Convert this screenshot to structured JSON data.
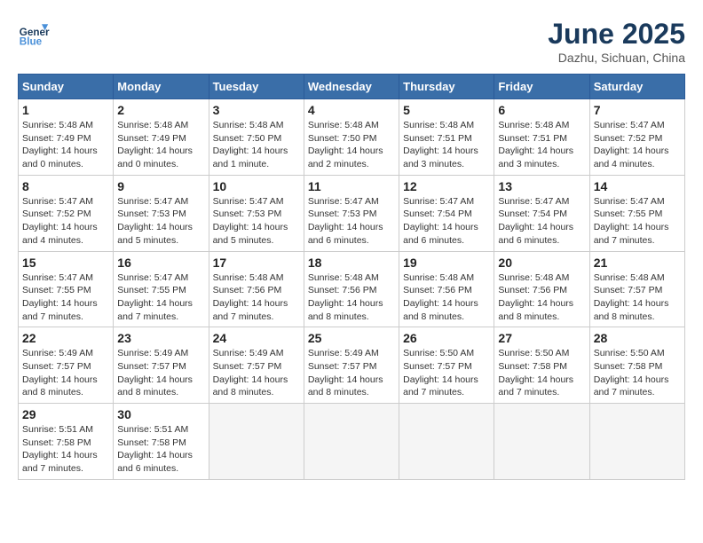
{
  "header": {
    "logo_line1": "General",
    "logo_line2": "Blue",
    "month": "June 2025",
    "location": "Dazhu, Sichuan, China"
  },
  "weekdays": [
    "Sunday",
    "Monday",
    "Tuesday",
    "Wednesday",
    "Thursday",
    "Friday",
    "Saturday"
  ],
  "weeks": [
    [
      {
        "day": "1",
        "sunrise": "5:48 AM",
        "sunset": "7:49 PM",
        "daylight": "14 hours and 0 minutes."
      },
      {
        "day": "2",
        "sunrise": "5:48 AM",
        "sunset": "7:49 PM",
        "daylight": "14 hours and 0 minutes."
      },
      {
        "day": "3",
        "sunrise": "5:48 AM",
        "sunset": "7:50 PM",
        "daylight": "14 hours and 1 minute."
      },
      {
        "day": "4",
        "sunrise": "5:48 AM",
        "sunset": "7:50 PM",
        "daylight": "14 hours and 2 minutes."
      },
      {
        "day": "5",
        "sunrise": "5:48 AM",
        "sunset": "7:51 PM",
        "daylight": "14 hours and 3 minutes."
      },
      {
        "day": "6",
        "sunrise": "5:48 AM",
        "sunset": "7:51 PM",
        "daylight": "14 hours and 3 minutes."
      },
      {
        "day": "7",
        "sunrise": "5:47 AM",
        "sunset": "7:52 PM",
        "daylight": "14 hours and 4 minutes."
      }
    ],
    [
      {
        "day": "8",
        "sunrise": "5:47 AM",
        "sunset": "7:52 PM",
        "daylight": "14 hours and 4 minutes."
      },
      {
        "day": "9",
        "sunrise": "5:47 AM",
        "sunset": "7:53 PM",
        "daylight": "14 hours and 5 minutes."
      },
      {
        "day": "10",
        "sunrise": "5:47 AM",
        "sunset": "7:53 PM",
        "daylight": "14 hours and 5 minutes."
      },
      {
        "day": "11",
        "sunrise": "5:47 AM",
        "sunset": "7:53 PM",
        "daylight": "14 hours and 6 minutes."
      },
      {
        "day": "12",
        "sunrise": "5:47 AM",
        "sunset": "7:54 PM",
        "daylight": "14 hours and 6 minutes."
      },
      {
        "day": "13",
        "sunrise": "5:47 AM",
        "sunset": "7:54 PM",
        "daylight": "14 hours and 6 minutes."
      },
      {
        "day": "14",
        "sunrise": "5:47 AM",
        "sunset": "7:55 PM",
        "daylight": "14 hours and 7 minutes."
      }
    ],
    [
      {
        "day": "15",
        "sunrise": "5:47 AM",
        "sunset": "7:55 PM",
        "daylight": "14 hours and 7 minutes."
      },
      {
        "day": "16",
        "sunrise": "5:47 AM",
        "sunset": "7:55 PM",
        "daylight": "14 hours and 7 minutes."
      },
      {
        "day": "17",
        "sunrise": "5:48 AM",
        "sunset": "7:56 PM",
        "daylight": "14 hours and 7 minutes."
      },
      {
        "day": "18",
        "sunrise": "5:48 AM",
        "sunset": "7:56 PM",
        "daylight": "14 hours and 8 minutes."
      },
      {
        "day": "19",
        "sunrise": "5:48 AM",
        "sunset": "7:56 PM",
        "daylight": "14 hours and 8 minutes."
      },
      {
        "day": "20",
        "sunrise": "5:48 AM",
        "sunset": "7:56 PM",
        "daylight": "14 hours and 8 minutes."
      },
      {
        "day": "21",
        "sunrise": "5:48 AM",
        "sunset": "7:57 PM",
        "daylight": "14 hours and 8 minutes."
      }
    ],
    [
      {
        "day": "22",
        "sunrise": "5:49 AM",
        "sunset": "7:57 PM",
        "daylight": "14 hours and 8 minutes."
      },
      {
        "day": "23",
        "sunrise": "5:49 AM",
        "sunset": "7:57 PM",
        "daylight": "14 hours and 8 minutes."
      },
      {
        "day": "24",
        "sunrise": "5:49 AM",
        "sunset": "7:57 PM",
        "daylight": "14 hours and 8 minutes."
      },
      {
        "day": "25",
        "sunrise": "5:49 AM",
        "sunset": "7:57 PM",
        "daylight": "14 hours and 8 minutes."
      },
      {
        "day": "26",
        "sunrise": "5:50 AM",
        "sunset": "7:57 PM",
        "daylight": "14 hours and 7 minutes."
      },
      {
        "day": "27",
        "sunrise": "5:50 AM",
        "sunset": "7:58 PM",
        "daylight": "14 hours and 7 minutes."
      },
      {
        "day": "28",
        "sunrise": "5:50 AM",
        "sunset": "7:58 PM",
        "daylight": "14 hours and 7 minutes."
      }
    ],
    [
      {
        "day": "29",
        "sunrise": "5:51 AM",
        "sunset": "7:58 PM",
        "daylight": "14 hours and 7 minutes."
      },
      {
        "day": "30",
        "sunrise": "5:51 AM",
        "sunset": "7:58 PM",
        "daylight": "14 hours and 6 minutes."
      },
      null,
      null,
      null,
      null,
      null
    ]
  ]
}
